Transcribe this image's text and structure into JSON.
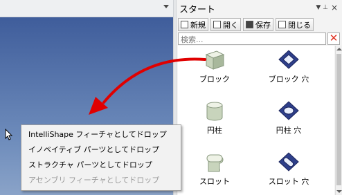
{
  "panel": {
    "title": "スタート",
    "pin": "▼ ⊥",
    "close": "×",
    "toolbar": [
      {
        "label": "新規",
        "icon": "new-icon"
      },
      {
        "label": "開く",
        "icon": "open-icon"
      },
      {
        "label": "保存",
        "icon": "save-icon"
      },
      {
        "label": "閉じる",
        "icon": "close-doc-icon"
      }
    ],
    "search_placeholder": "検索...",
    "clear": "✕",
    "tiles": [
      {
        "label": "ブロック",
        "icon": "block-icon"
      },
      {
        "label": "ブロック 穴",
        "icon": "block-hole-icon"
      },
      {
        "label": "円柱",
        "icon": "cylinder-icon"
      },
      {
        "label": "円柱 穴",
        "icon": "cylinder-hole-icon"
      },
      {
        "label": "スロット",
        "icon": "slot-icon"
      },
      {
        "label": "スロット 穴",
        "icon": "slot-hole-icon"
      }
    ]
  },
  "context_menu": {
    "items": [
      {
        "label": "IntelliShape フィーチャとしてドロップ",
        "enabled": true
      },
      {
        "label": "イノベイティブ パーツとしてドロップ",
        "enabled": true
      },
      {
        "label": "ストラクチャ パーツとしてドロップ",
        "enabled": true
      },
      {
        "label": "アセンブリ フィーチャとしてドロップ",
        "enabled": false
      }
    ]
  },
  "colors": {
    "viewport_top": "#3f5d9b",
    "viewport_bottom": "#8aa3c8",
    "drag_arrow": "#e00000"
  }
}
